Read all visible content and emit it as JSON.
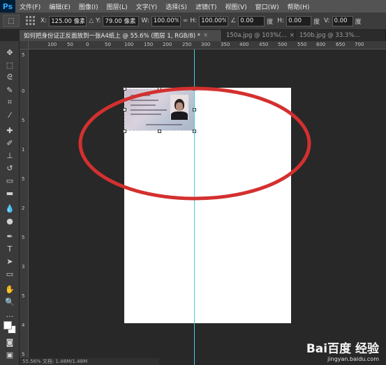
{
  "app": {
    "logo": "Ps"
  },
  "menu": [
    "文件(F)",
    "编辑(E)",
    "图像(I)",
    "图层(L)",
    "文字(Y)",
    "选择(S)",
    "滤镜(T)",
    "视图(V)",
    "窗口(W)",
    "帮助(H)"
  ],
  "options": {
    "x_label": "X:",
    "x_value": "125.00 像素",
    "y_label": "Y:",
    "y_value": "79.00 像素",
    "w_label": "W:",
    "w_value": "100.00%",
    "h_label": "H:",
    "h_value": "100.00%",
    "angle_value": "0.00",
    "angle_unit": "度",
    "hskew_label": "H:",
    "hskew_value": "0.00",
    "hskew_unit": "度",
    "vskew_label": "V:",
    "vskew_value": "0.00",
    "vskew_unit": "度",
    "link_icon": "link-icon",
    "angle_icon": "angle-icon",
    "delta_icon": "delta-icon"
  },
  "tabs": [
    {
      "label": "如何把身份证正反面放到一张A4纸上 @ 55.6% (图层 1, RGB/8) *",
      "active": true
    },
    {
      "label": "150a.jpg @ 103%(...",
      "active": false
    },
    {
      "label": "150b.jpg @ 33.3%...",
      "active": false
    }
  ],
  "rulers": {
    "top": [
      "100",
      "50",
      "0",
      "50",
      "100",
      "150",
      "200",
      "250",
      "300",
      "350",
      "400",
      "450",
      "500",
      "550",
      "600",
      "650",
      "700"
    ],
    "left": [
      "5",
      "0",
      "5",
      "1",
      "5",
      "2",
      "5",
      "3",
      "5",
      "4",
      "5"
    ]
  },
  "watermark": {
    "logo": "Bai百度 经验",
    "url": "jingyan.baidu.com"
  },
  "status": {
    "text": "55.56%   文档: 1.48M/1.48M"
  },
  "colors": {
    "annotation": "#d3302f",
    "guide": "#3fd0d8",
    "menubar": "#535353",
    "workspace": "#282828"
  }
}
